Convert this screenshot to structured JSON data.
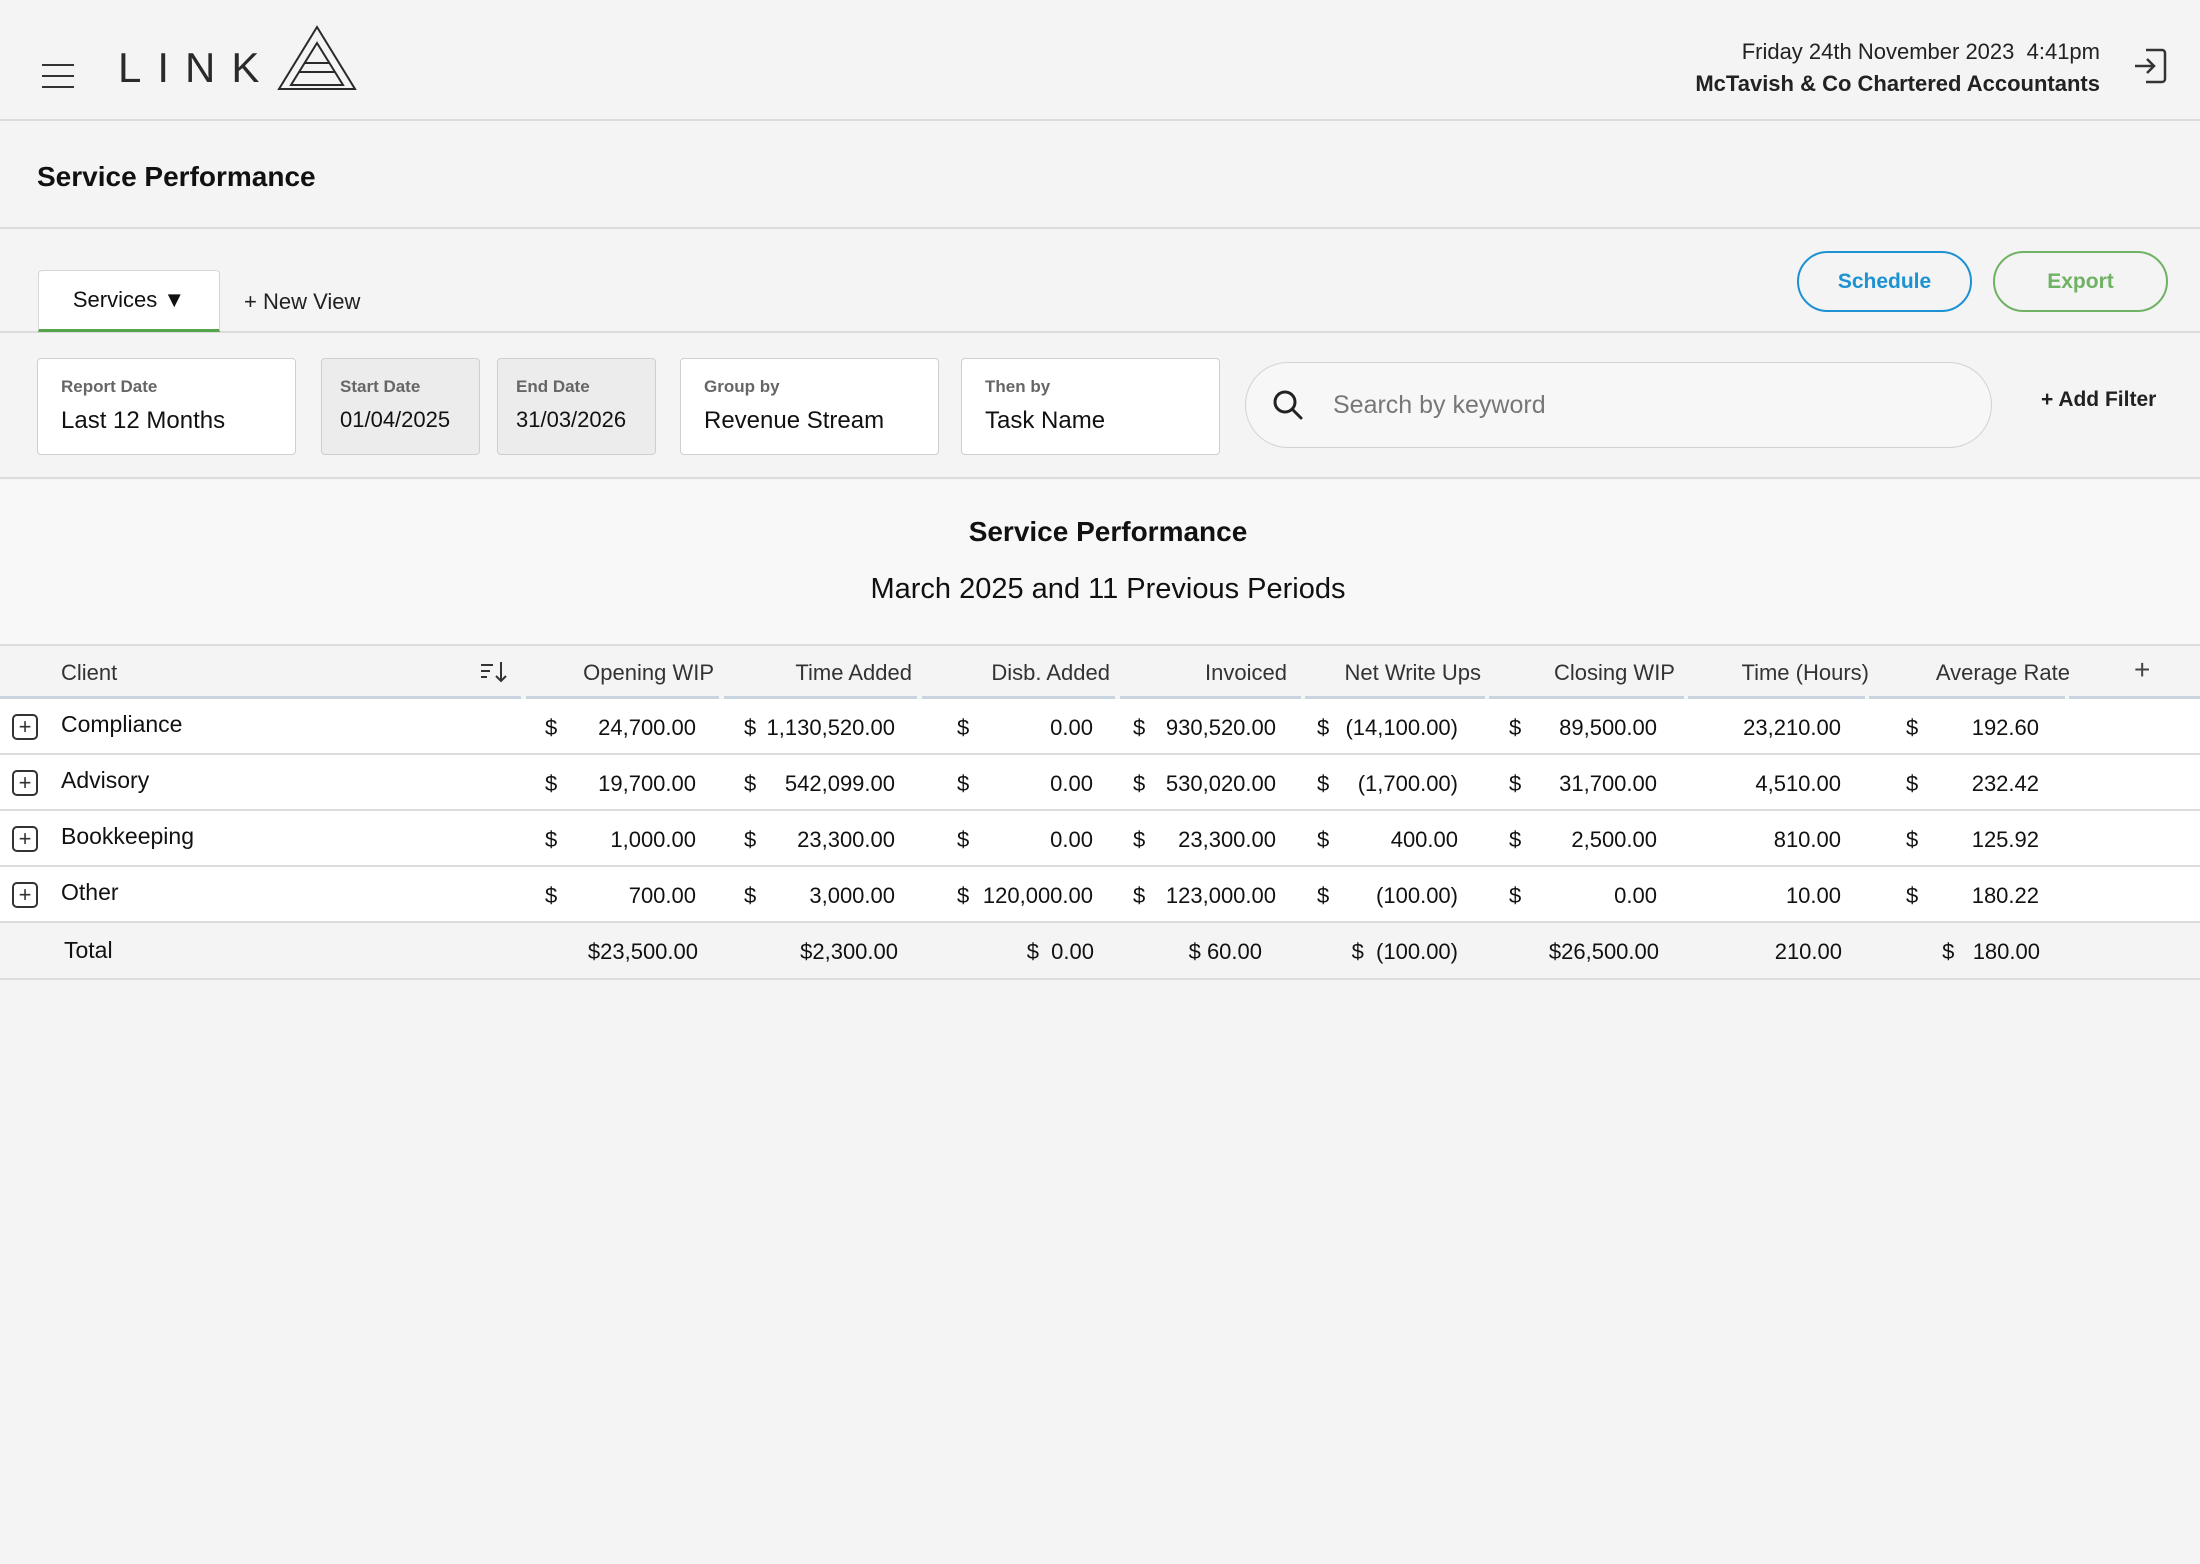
{
  "header": {
    "logo_text": "LINK",
    "date": "Friday 24th November 2023  4:41pm",
    "firm": "McTavish & Co Chartered Accountants"
  },
  "page": {
    "title": "Service Performance"
  },
  "tabs": {
    "active": "Services ▼",
    "new_view": "+ New View"
  },
  "actions": {
    "schedule": "Schedule",
    "export": "Export"
  },
  "filters": {
    "report_date": {
      "label": "Report Date",
      "value": "Last 12 Months"
    },
    "start_date": {
      "label": "Start Date",
      "value": "01/04/2025"
    },
    "end_date": {
      "label": "End Date",
      "value": "31/03/2026"
    },
    "group_by": {
      "label": "Group by",
      "value": "Revenue Stream"
    },
    "then_by": {
      "label": "Then by",
      "value": "Task Name"
    },
    "search_placeholder": "Search by keyword",
    "add_filter": "+ Add Filter"
  },
  "report": {
    "title": "Service Performance",
    "subtitle": "March 2025 and 11 Previous Periods"
  },
  "table": {
    "columns": [
      "Client",
      "Opening WIP",
      "Time Added",
      "Disb. Added",
      "Invoiced",
      "Net Write Ups",
      "Closing WIP",
      "Time (Hours)",
      "Average Rate"
    ],
    "add_column": "+",
    "rows": [
      {
        "name": "Compliance",
        "cells": [
          [
            "$",
            "24,700.00"
          ],
          [
            "$",
            "1,130,520.00"
          ],
          [
            "$",
            "0.00"
          ],
          [
            "$",
            "930,520.00"
          ],
          [
            "$",
            "(14,100.00)"
          ],
          [
            "$",
            "89,500.00"
          ],
          [
            "",
            "23,210.00"
          ],
          [
            "$",
            "192.60"
          ]
        ]
      },
      {
        "name": "Advisory",
        "cells": [
          [
            "$",
            "19,700.00"
          ],
          [
            "$",
            "542,099.00"
          ],
          [
            "$",
            "0.00"
          ],
          [
            "$",
            "530,020.00"
          ],
          [
            "$",
            "(1,700.00)"
          ],
          [
            "$",
            "31,700.00"
          ],
          [
            "",
            "4,510.00"
          ],
          [
            "$",
            "232.42"
          ]
        ]
      },
      {
        "name": "Bookkeeping",
        "cells": [
          [
            "$",
            "1,000.00"
          ],
          [
            "$",
            "23,300.00"
          ],
          [
            "$",
            "0.00"
          ],
          [
            "$",
            "23,300.00"
          ],
          [
            "$",
            "400.00"
          ],
          [
            "$",
            "2,500.00"
          ],
          [
            "",
            "810.00"
          ],
          [
            "$",
            "125.92"
          ]
        ]
      },
      {
        "name": "Other",
        "cells": [
          [
            "$",
            "700.00"
          ],
          [
            "$",
            "3,000.00"
          ],
          [
            "$",
            "120,000.00"
          ],
          [
            "$",
            "123,000.00"
          ],
          [
            "$",
            "(100.00)"
          ],
          [
            "$",
            "0.00"
          ],
          [
            "",
            "10.00"
          ],
          [
            "$",
            "180.22"
          ]
        ]
      }
    ],
    "total": {
      "name": "Total",
      "cells": [
        "$23,500.00",
        "$2,300.00",
        "$  0.00",
        "$ 60.00",
        "$  (100.00)",
        "$26,500.00",
        "210.00",
        "$   180.00"
      ]
    }
  }
}
